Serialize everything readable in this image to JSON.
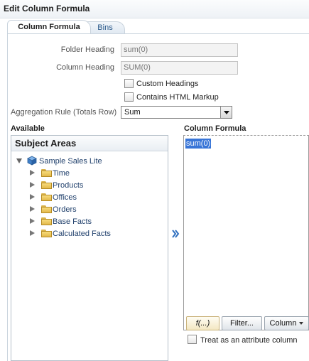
{
  "dialog": {
    "title": "Edit Column Formula"
  },
  "tabs": [
    {
      "label": "Column Formula",
      "active": true
    },
    {
      "label": "Bins",
      "active": false
    }
  ],
  "form": {
    "folder_heading_label": "Folder Heading",
    "folder_heading_value": "sum(0)",
    "column_heading_label": "Column Heading",
    "column_heading_value": "SUM(0)",
    "custom_headings_label": "Custom Headings",
    "custom_headings_checked": false,
    "contains_html_label": "Contains HTML Markup",
    "contains_html_checked": false,
    "aggregation_label": "Aggregation Rule (Totals Row)",
    "aggregation_value": "Sum"
  },
  "available": {
    "section_label": "Available",
    "panel_title": "Subject Areas",
    "root": "Sample Sales Lite",
    "folders": [
      "Time",
      "Products",
      "Offices",
      "Orders",
      "Base Facts",
      "Calculated Facts"
    ]
  },
  "column_formula": {
    "section_label": "Column Formula",
    "formula_text": "sum(0)",
    "buttons": {
      "fx": "f(...)",
      "filter": "Filter...",
      "column": "Column"
    },
    "attribute_checkbox_label": "Treat as an attribute column",
    "attribute_checked": false
  },
  "icons": {
    "move_right": "double-chevron-right-icon",
    "subject_area": "cube-icon",
    "folder": "folder-icon"
  },
  "colors": {
    "selection": "#3875d7",
    "link_text": "#1f3f6b",
    "arrow_blue": "#2f6fbf"
  }
}
